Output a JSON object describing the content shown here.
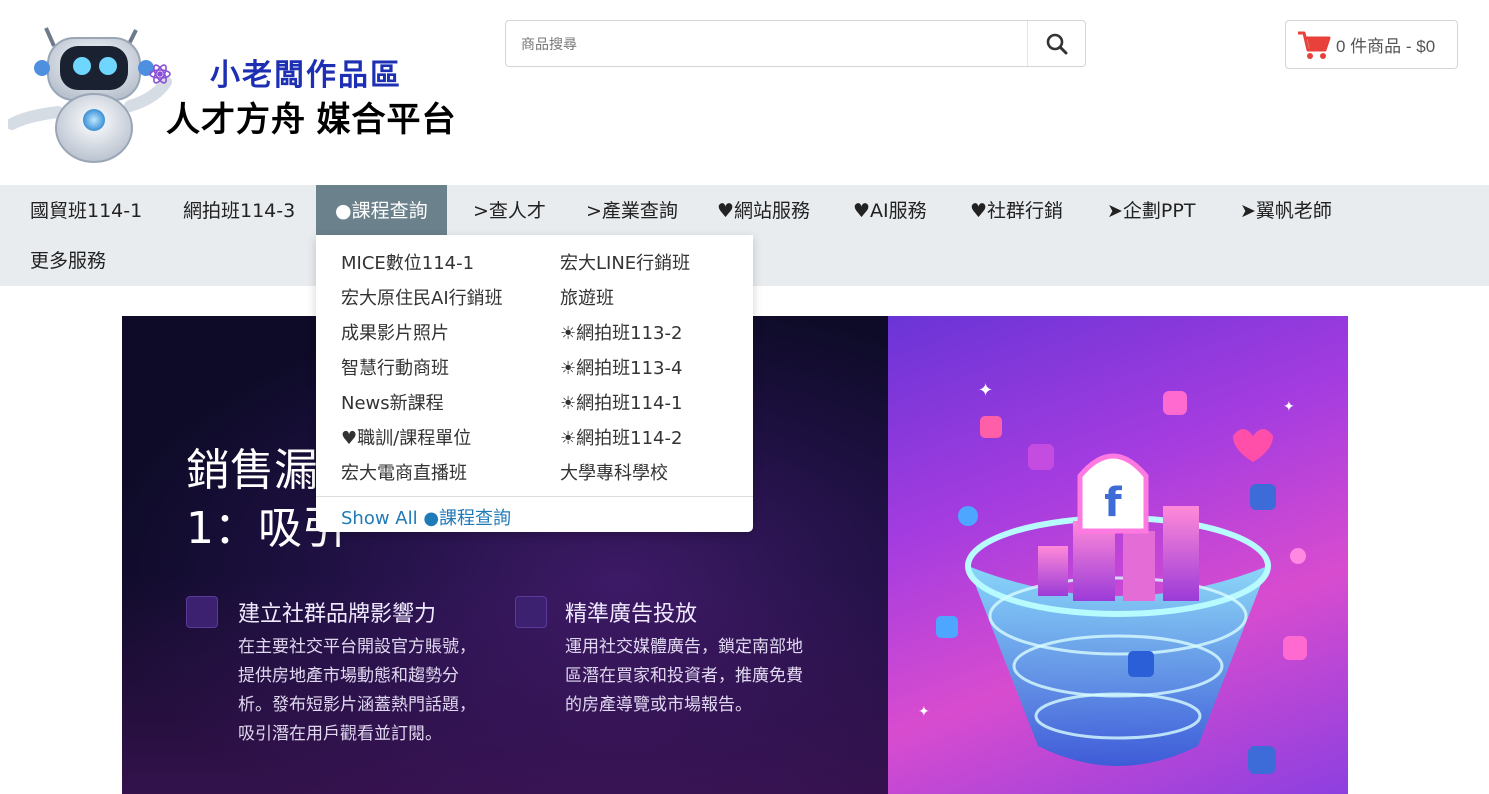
{
  "logo": {
    "line1": "小老闆作品區",
    "line2": "人才方舟 媒合平台"
  },
  "search": {
    "placeholder": "商品搜尋",
    "value": ""
  },
  "cart": {
    "label": "0 件商品 - $0"
  },
  "colors": {
    "brand_blue": "#1d2fb3",
    "nav_active": "#6b818c",
    "link": "#1f7ab8",
    "cart_icon": "#e8413b"
  },
  "nav": {
    "items": [
      {
        "label": "國貿班114-1"
      },
      {
        "label": "網拍班114-3"
      },
      {
        "label": "●課程查詢",
        "active": true
      },
      {
        "label": ">查人才"
      },
      {
        "label": ">產業查詢"
      },
      {
        "label": "♥網站服務"
      },
      {
        "label": "♥AI服務"
      },
      {
        "label": "♥社群行銷"
      },
      {
        "label": "➤企劃PPT"
      },
      {
        "label": "➤翼帆老師"
      },
      {
        "label": "更多服務"
      }
    ]
  },
  "dropdown": {
    "left_items": [
      "MICE數位114-1",
      "宏大原住民AI行銷班",
      "成果影片照片",
      "智慧行動商班",
      "News新課程",
      "♥職訓/課程單位",
      "宏大電商直播班"
    ],
    "right_items": [
      "宏大LINE行銷班",
      "旅遊班",
      "☀網拍班113-2",
      "☀網拍班113-4",
      "☀網拍班114-1",
      "☀網拍班114-2",
      "大學專科學校"
    ],
    "show_all": "Show All ●課程查詢"
  },
  "banner": {
    "title_line1": "銷售漏",
    "title_line2": "1：吸引",
    "features": [
      {
        "title": "建立社群品牌影響力",
        "desc": [
          "在主要社交平台開設官方賬號，",
          "提供房地產市場動態和趨勢分",
          "析。發布短影片涵蓋熱門話題，",
          "吸引潛在用戶觀看並訂閱。"
        ]
      },
      {
        "title": "精準廣告投放",
        "desc": [
          "運用社交媒體廣告，鎖定南部地",
          "區潛在買家和投資者，推廣免費",
          "的房產導覽或市場報告。"
        ]
      }
    ]
  }
}
